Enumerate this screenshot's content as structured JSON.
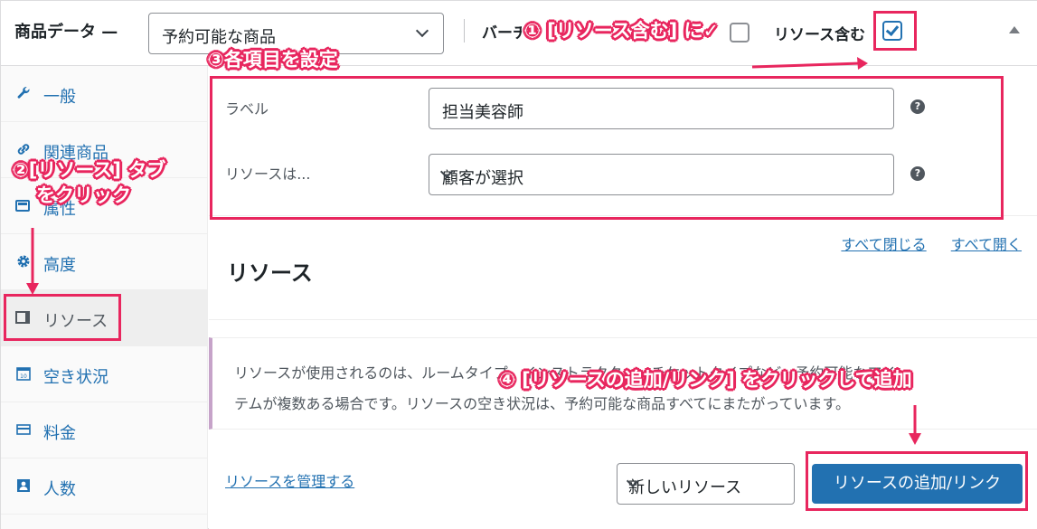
{
  "header": {
    "title": "商品データ —",
    "product_type": "予約可能な商品",
    "virtual_label": "バーチャル",
    "resource_label": "リソース含む"
  },
  "sidebar": {
    "items": [
      {
        "label": "一般",
        "icon": "wrench-icon"
      },
      {
        "label": "関連商品",
        "icon": "link-icon"
      },
      {
        "label": "属性",
        "icon": "list-icon"
      },
      {
        "label": "高度",
        "icon": "gear-icon"
      },
      {
        "label": "リソース",
        "icon": "resource-icon",
        "active": true
      },
      {
        "label": "空き状況",
        "icon": "calendar-icon"
      },
      {
        "label": "料金",
        "icon": "card-icon"
      },
      {
        "label": "人数",
        "icon": "person-icon"
      }
    ]
  },
  "main": {
    "label_field": {
      "label": "ラベル",
      "value": "担当美容師"
    },
    "resource_field": {
      "label": "リソースは...",
      "value": "顧客が選択"
    },
    "close_all": "すべて閉じる",
    "open_all": "すべて開く",
    "section_title": "リソース",
    "notice": "リソースが使用されるのは、ルームタイプ、インストラクター、チケットタイプなど、予約可能なアイテムが複数ある場合です。リソースの空き状況は、予約可能な商品すべてにまたがっています。",
    "manage_link": "リソースを管理する",
    "new_resource": "新しいリソース",
    "add_button": "リソースの追加/リンク"
  },
  "annotations": {
    "step1": "① [リソース含む] に✓",
    "step2_line1": "②[リソース] タブ",
    "step2_line2": "をクリック",
    "step3": "③各項目を設定",
    "step4": "④ [リソースの追加/リンク] をクリックして追加"
  },
  "colors": {
    "accent": "#2271b1",
    "annotation": "#e8265e"
  }
}
